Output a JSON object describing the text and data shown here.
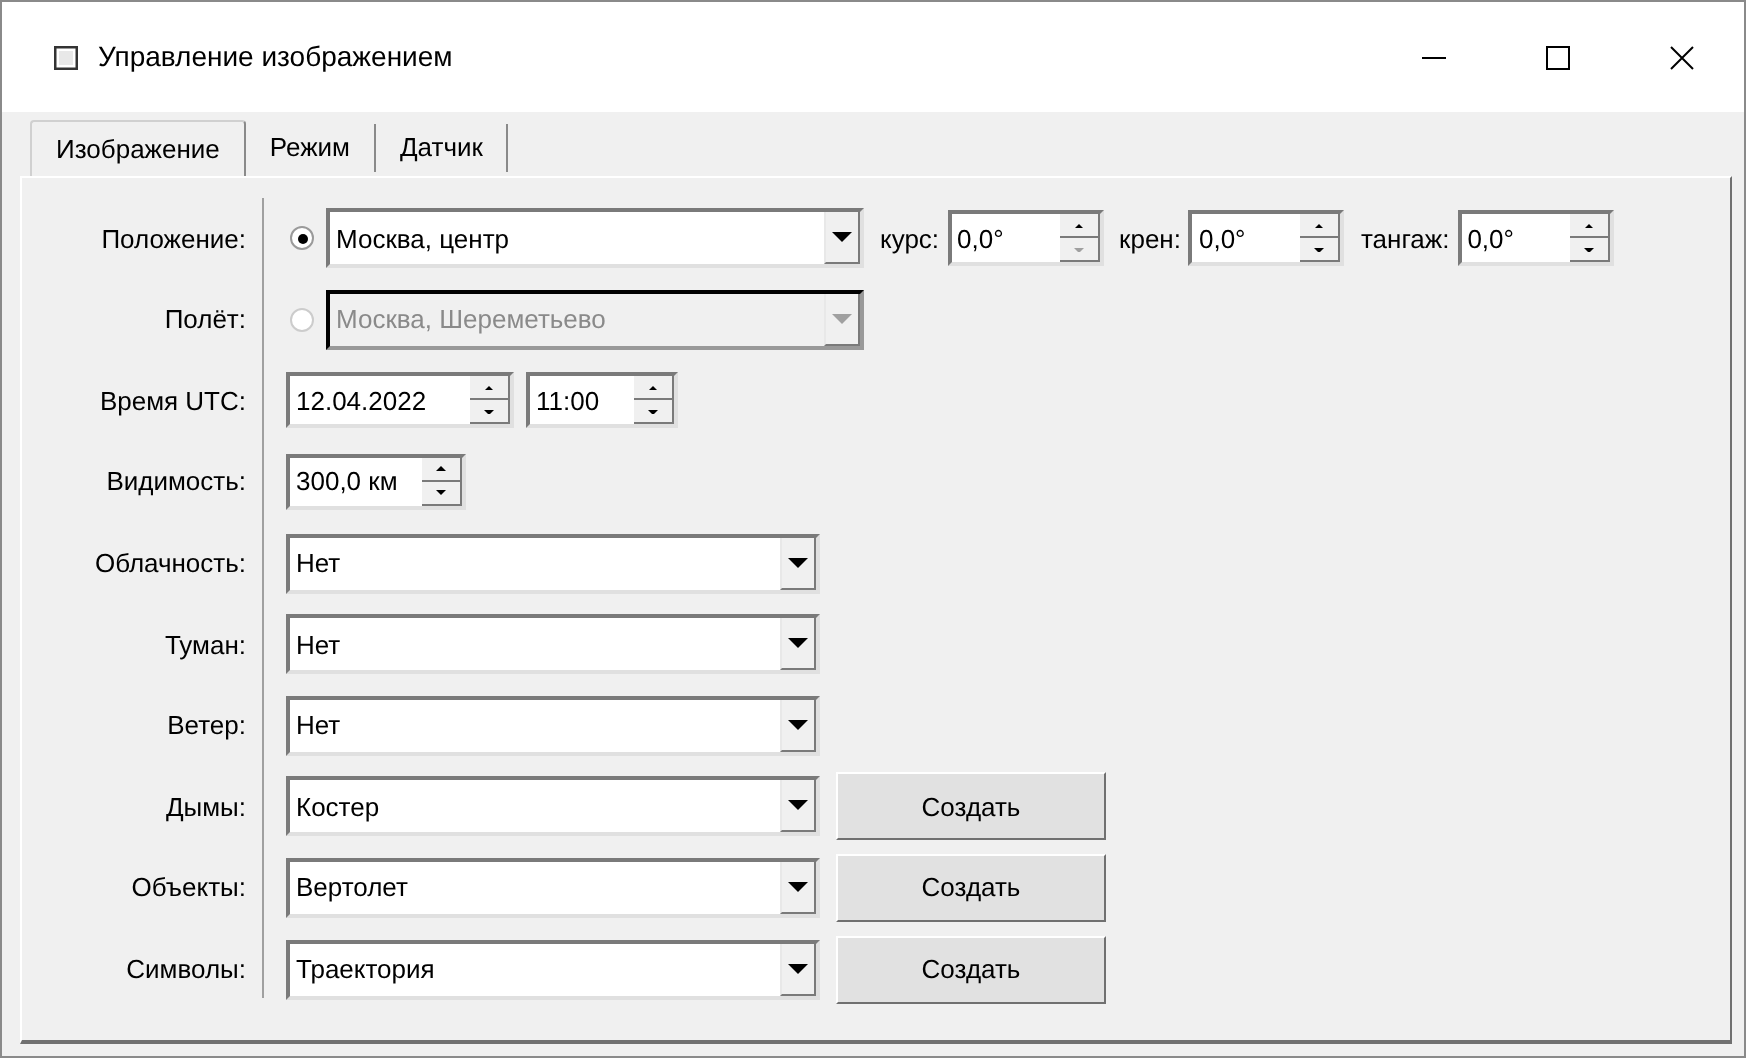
{
  "window": {
    "title": "Управление изображением"
  },
  "tabs": [
    {
      "label": "Изображение",
      "selected": true
    },
    {
      "label": "Режим",
      "selected": false
    },
    {
      "label": "Датчик",
      "selected": false
    }
  ],
  "rows": [
    {
      "label": "Положение:",
      "kind": "radio-combo",
      "selected": true,
      "value": "Москва, центр",
      "disabled": false,
      "spinners": [
        {
          "label": "курс:",
          "value": "0,0°",
          "down_disabled": true
        },
        {
          "label": "крен:",
          "value": "0,0°",
          "down_disabled": false
        },
        {
          "label": "тангаж:",
          "value": "0,0°",
          "down_disabled": false
        }
      ]
    },
    {
      "label": "Полёт:",
      "kind": "radio-combo",
      "selected": false,
      "value": "Москва, Шереметьево",
      "disabled": true
    },
    {
      "label": "Время UTC:",
      "kind": "spinners",
      "spinners": [
        {
          "value": "12.04.2022",
          "down_disabled": false
        },
        {
          "value": "11:00",
          "down_disabled": false
        }
      ]
    },
    {
      "label": "Видимость:",
      "kind": "spinners",
      "spinners": [
        {
          "value": "300,0 км",
          "down_disabled": false
        }
      ]
    },
    {
      "label": "Облачность:",
      "kind": "combo",
      "value": "Нет"
    },
    {
      "label": "Туман:",
      "kind": "combo",
      "value": "Нет"
    },
    {
      "label": "Ветер:",
      "kind": "combo",
      "value": "Нет"
    },
    {
      "label": "Дымы:",
      "kind": "combo",
      "value": "Костер",
      "button": "Создать"
    },
    {
      "label": "Объекты:",
      "kind": "combo",
      "value": "Вертолет",
      "button": "Создать"
    },
    {
      "label": "Символы:",
      "kind": "combo",
      "value": "Траектория",
      "button": "Создать"
    }
  ]
}
